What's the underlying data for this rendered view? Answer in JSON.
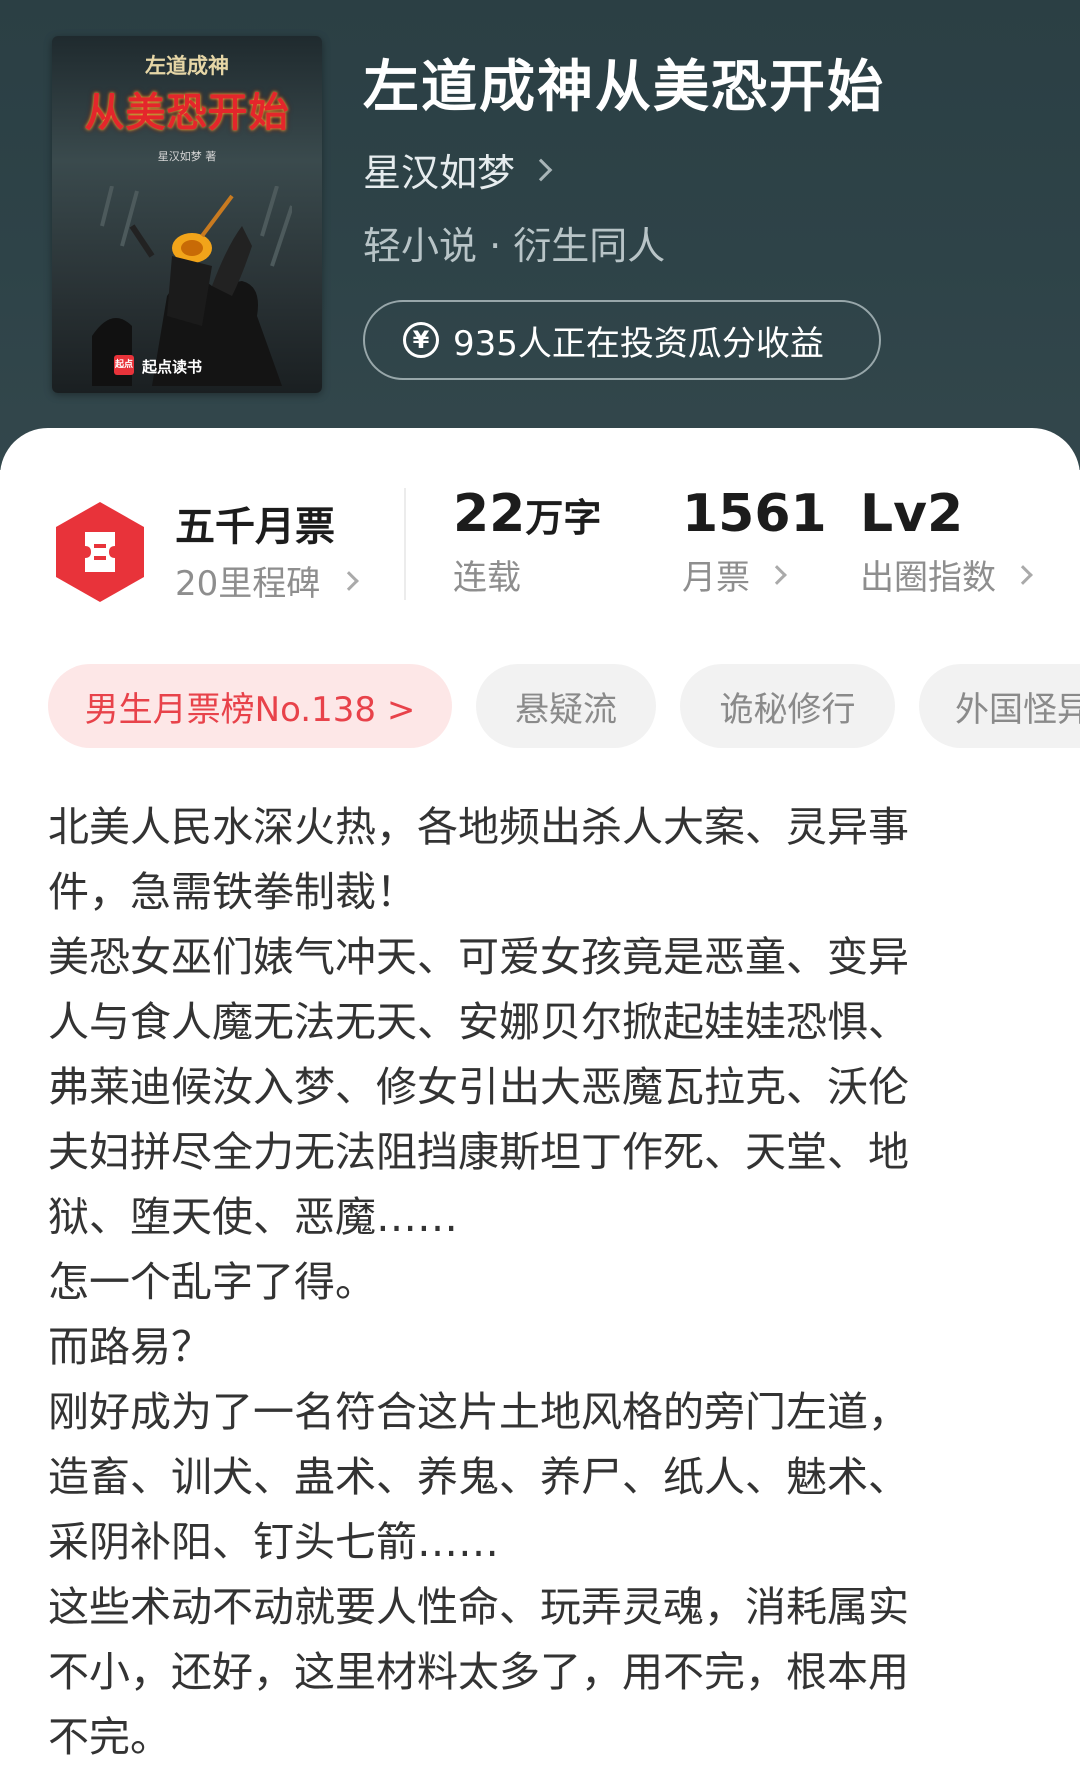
{
  "cover": {
    "top_text": "左道成神",
    "title_text": "从美恐开始",
    "author_text": "星汉如梦 著",
    "brand_text": "起点读书",
    "brand_logo_text": "起点"
  },
  "book": {
    "title": "左道成神从美恐开始",
    "author": "星汉如梦",
    "category": "轻小说 · 衍生同人",
    "invest_label": "935人正在投资瓜分收益"
  },
  "stats": {
    "ticket_name": "五千月票",
    "milestone": "20里程碑",
    "word_count_value": "22",
    "word_count_unit": "万字",
    "word_count_label": "连载",
    "monthly_votes_value": "1561",
    "monthly_votes_label": "月票",
    "circle_index_value": "Lv2",
    "circle_index_label": "出圈指数"
  },
  "tags": [
    "男生月票榜No.138 >",
    "悬疑流",
    "诡秘修行",
    "外国怪异"
  ],
  "synopsis": [
    "北美人民水深火热，各地频出杀人大案、灵异事",
    "件，急需铁拳制裁！",
    "美恐女巫们婊气冲天、可爱女孩竟是恶童、变异",
    "人与食人魔无法无天、安娜贝尔掀起娃娃恐惧、",
    "弗莱迪候汝入梦、修女引出大恶魔瓦拉克、沃伦",
    "夫妇拼尽全力无法阻挡康斯坦丁作死、天堂、地",
    "狱、堕天使、恶魔……",
    "怎一个乱字了得。",
    "而路易？",
    "刚好成为了一名符合这片土地风格的旁门左道，",
    "造畜、训犬、蛊术、养鬼、养尸、纸人、魅术、",
    "采阴补阳、钉头七箭……",
    "这些术动不动就要人性命、玩弄灵魂，消耗属实",
    "不小，还好，这里材料太多了，用不完，根本用",
    "不完。"
  ],
  "colors": {
    "header_bg": "#2e4348",
    "accent_red": "#e8424a",
    "badge_red": "#e8333a"
  }
}
